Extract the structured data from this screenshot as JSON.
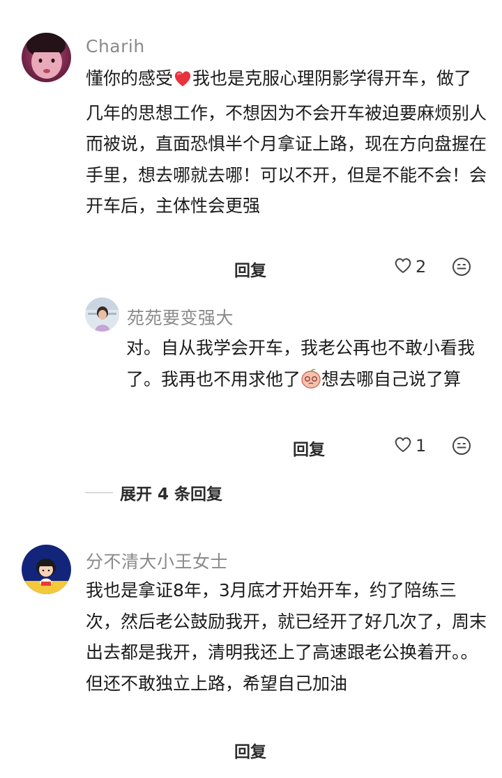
{
  "comments": [
    {
      "username": "Charih",
      "text_part1": "懂你的感受",
      "text_part2": "我也是克服心理阴影学得开车，做了几年的思想工作，不想因为不会开车被迫要麻烦别人而被说，直面恐惧半个月拿证上路，现在方向盘握在手里，想去哪就去哪！可以不开，但是不能不会！会开车后，主体性会更强",
      "reply_label": "回复",
      "like_count": "2",
      "replies": [
        {
          "username": "苑苑要变强大",
          "text_part1": "对。自从我学会开车，我老公再也不敢小看我了。我再也不用求他了",
          "text_part2": "想去哪自己说了算",
          "reply_label": "回复",
          "like_count": "1"
        }
      ],
      "expand_label": "展开 4 条回复"
    },
    {
      "username": "分不清大小王女士",
      "text": "我也是拿证8年，3月底才开始开车，约了陪练三次，然后老公鼓励我开，就已经开了好几次了，周末出去都是我开，清明我还上了高速跟老公换着开。。但还不敢独立上路，希望自己加油",
      "reply_label": "回复"
    }
  ],
  "icons": {
    "heart_inline": "red-heart-emoji",
    "peach_inline": "peach-emoji",
    "like": "heart-outline-icon",
    "emoji": "smiley-icon"
  },
  "colors": {
    "username": "#8a8a8a",
    "text": "#1b1b1b",
    "heart_emoji": "#e8323c"
  }
}
